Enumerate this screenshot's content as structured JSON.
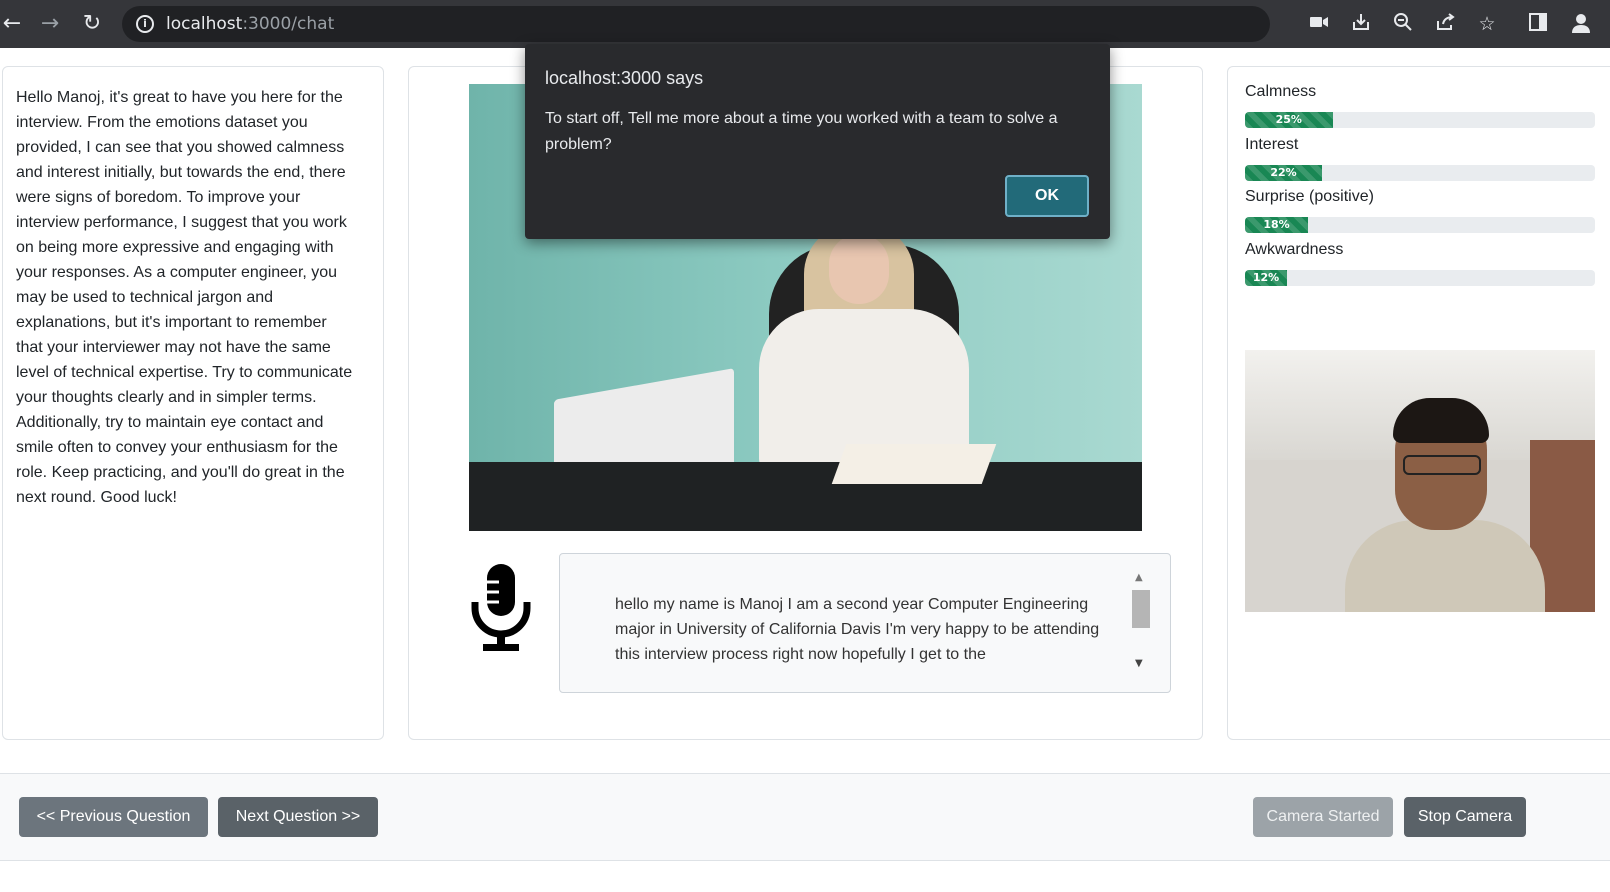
{
  "browser": {
    "url_host": "localhost",
    "url_rest": ":3000/chat",
    "back_icon": "arrow-left",
    "forward_icon": "arrow-right",
    "reload_icon": "reload",
    "info_icon": "i"
  },
  "feedback": {
    "text": "Hello Manoj, it's great to have you here for the interview. From the emotions dataset you provided, I can see that you showed calmness and interest initially, but towards the end, there were signs of boredom. To improve your interview performance, I suggest that you work on being more expressive and engaging with your responses. As a computer engineer, you may be used to technical jargon and explanations, but it's important to remember that your interviewer may not have the same level of technical expertise. Try to communicate your thoughts clearly and in simpler terms. Additionally, try to maintain eye contact and smile often to convey your enthusiasm for the role. Keep practicing, and you'll do great in the next round. Good luck!"
  },
  "transcript": {
    "text": "hello my name is Manoj I am a second year Computer Engineering major in University of California Davis I'm very happy to be attending this interview process right now hopefully I get to the"
  },
  "emotions": [
    {
      "label": "Calmness",
      "percent_label": "25%",
      "value": 25
    },
    {
      "label": "Interest",
      "percent_label": "22%",
      "value": 22
    },
    {
      "label": "Surprise (positive)",
      "percent_label": "18%",
      "value": 18
    },
    {
      "label": "Awkwardness",
      "percent_label": "12%",
      "value": 12
    }
  ],
  "footer": {
    "prev_label": "<< Previous Question",
    "next_label": "Next Question >>",
    "camera_started_label": "Camera Started",
    "stop_camera_label": "Stop Camera"
  },
  "dialog": {
    "title": "localhost:3000 says",
    "message": "To start off, Tell me more about a time you worked with a team to solve a problem?",
    "ok_label": "OK"
  },
  "colors": {
    "progress": "#198754",
    "dialog_bg": "#292a2d",
    "ok_button": "#226a79",
    "button": "#6c757d"
  }
}
